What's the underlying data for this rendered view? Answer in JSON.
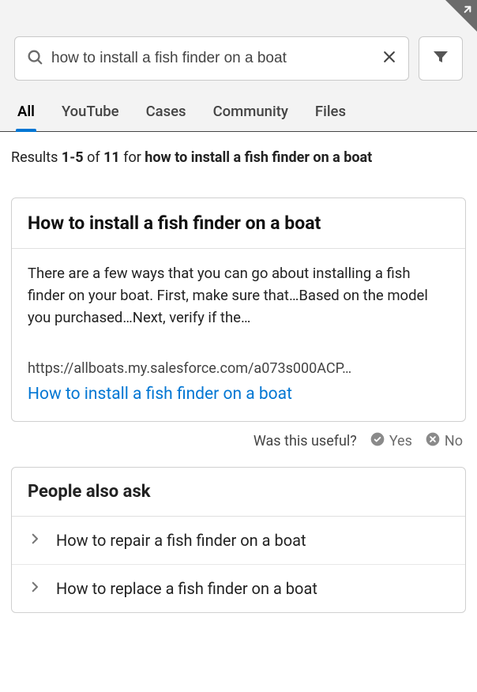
{
  "search": {
    "query": "how to install a fish finder on a boat",
    "placeholder": "Search"
  },
  "tabs": [
    {
      "id": "all",
      "label": "All",
      "active": true
    },
    {
      "id": "youtube",
      "label": "YouTube",
      "active": false
    },
    {
      "id": "cases",
      "label": "Cases",
      "active": false
    },
    {
      "id": "community",
      "label": "Community",
      "active": false
    },
    {
      "id": "files",
      "label": "Files",
      "active": false
    }
  ],
  "results": {
    "prefix": "Results ",
    "range": "1-5",
    "of": " of ",
    "total": "11",
    "for": " for ",
    "query": "how to install a fish finder on a boat"
  },
  "answer": {
    "title": "How to install a fish finder on a boat",
    "snippet": "There are a few ways that you can go about installing a fish finder on your boat. First, make sure that…Based on the model you purchased…Next, verify if the…",
    "source_url": "https://allboats.my.salesforce.com/a073s000ACP…",
    "source_title": "How to install a fish finder on a boat"
  },
  "feedback": {
    "prompt": "Was this useful?",
    "yes": "Yes",
    "no": "No"
  },
  "people_also_ask": {
    "title": "People also ask",
    "items": [
      "How to repair a fish finder on a boat",
      "How to replace a fish finder on a boat"
    ]
  }
}
